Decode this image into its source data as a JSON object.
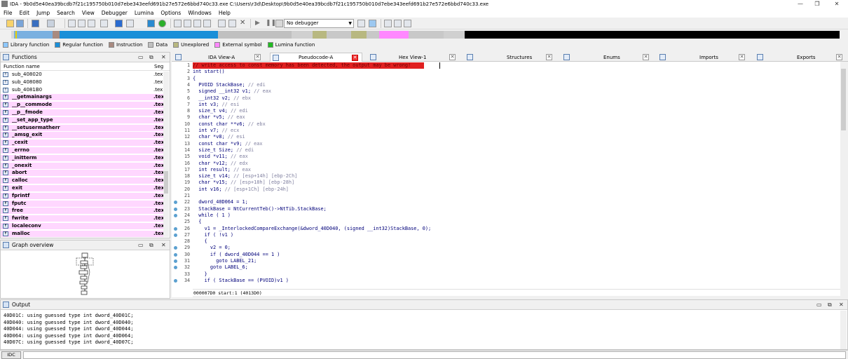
{
  "window": {
    "title": "IDA - 9b0d5e40ea39bcdb7f21c195750b010d7ebe343eefd691b27e572e6bbd740c33.exe C:\\Users\\r3d\\Desktop\\9b0d5e40ea39bcdb7f21c195750b010d7ebe343eefd691b27e572e6bbd740c33.exe",
    "minimize": "—",
    "maximize": "❐",
    "close": "✕"
  },
  "menu": [
    "File",
    "Edit",
    "Jump",
    "Search",
    "View",
    "Debugger",
    "Lumina",
    "Options",
    "Windows",
    "Help"
  ],
  "toolbar": {
    "debugger_select": "No debugger"
  },
  "legend": [
    {
      "label": "Library function",
      "color": "#8ec8ff"
    },
    {
      "label": "Regular function",
      "color": "#1a8fd8"
    },
    {
      "label": "Instruction",
      "color": "#a88a80"
    },
    {
      "label": "Data",
      "color": "#c0c0c0"
    },
    {
      "label": "Unexplored",
      "color": "#b8b880"
    },
    {
      "label": "External symbol",
      "color": "#ff88ff"
    },
    {
      "label": "Lumina function",
      "color": "#22bb22"
    }
  ],
  "functions_panel": {
    "title": "Functions",
    "col_name": "Function name",
    "col_seg": "Seg",
    "rows": [
      {
        "name": "sub_408020",
        "seg": ".tex",
        "lib": false
      },
      {
        "name": "sub_408080",
        "seg": ".tex",
        "lib": false
      },
      {
        "name": "sub_4081B0",
        "seg": ".tex",
        "lib": false
      },
      {
        "name": "__getmainargs",
        "seg": ".tex",
        "lib": true
      },
      {
        "name": "__p__commode",
        "seg": ".tex",
        "lib": true
      },
      {
        "name": "__p__fmode",
        "seg": ".tex",
        "lib": true
      },
      {
        "name": "__set_app_type",
        "seg": ".tex",
        "lib": true
      },
      {
        "name": "__setusermatherr",
        "seg": ".tex",
        "lib": true
      },
      {
        "name": "_amsg_exit",
        "seg": ".tex",
        "lib": true
      },
      {
        "name": "_cexit",
        "seg": ".tex",
        "lib": true
      },
      {
        "name": "_errno",
        "seg": ".tex",
        "lib": true
      },
      {
        "name": "_initterm",
        "seg": ".tex",
        "lib": true
      },
      {
        "name": "_onexit",
        "seg": ".tex",
        "lib": true
      },
      {
        "name": "abort",
        "seg": ".tex",
        "lib": true
      },
      {
        "name": "calloc",
        "seg": ".tex",
        "lib": true
      },
      {
        "name": "exit",
        "seg": ".tex",
        "lib": true
      },
      {
        "name": "fprintf",
        "seg": ".tex",
        "lib": true
      },
      {
        "name": "fputc",
        "seg": ".tex",
        "lib": true
      },
      {
        "name": "free",
        "seg": ".tex",
        "lib": true
      },
      {
        "name": "fwrite",
        "seg": ".tex",
        "lib": true
      },
      {
        "name": "localeconv",
        "seg": ".tex",
        "lib": true
      },
      {
        "name": "malloc",
        "seg": ".tex",
        "lib": true
      }
    ]
  },
  "graph_overview": {
    "title": "Graph overview"
  },
  "tabs": [
    {
      "label": "IDA View-A",
      "active": false
    },
    {
      "label": "Pseudocode-A",
      "active": true
    },
    {
      "label": "Hex View-1",
      "active": false
    },
    {
      "label": "Structures",
      "active": false
    },
    {
      "label": "Enums",
      "active": false
    },
    {
      "label": "Imports",
      "active": false
    },
    {
      "label": "Exports",
      "active": false
    }
  ],
  "pseudocode": {
    "lines": [
      {
        "n": "1",
        "text": "// write access to const memory has been detected, the output may be wrong!",
        "warn": true,
        "dot": false
      },
      {
        "n": "2",
        "text": "int start()",
        "dot": false
      },
      {
        "n": "3",
        "text": "{",
        "dot": false
      },
      {
        "n": "4",
        "text": "  PVOID StackBase; // edi",
        "dot": false
      },
      {
        "n": "5",
        "text": "  signed __int32 v1; // eax",
        "dot": false
      },
      {
        "n": "6",
        "text": "  __int32 v2; // ebx",
        "dot": false
      },
      {
        "n": "7",
        "text": "  int v3; // esi",
        "dot": false
      },
      {
        "n": "8",
        "text": "  size_t v4; // edi",
        "dot": false
      },
      {
        "n": "9",
        "text": "  char *v5; // eax",
        "dot": false
      },
      {
        "n": "10",
        "text": "  const char **v6; // ebx",
        "dot": false
      },
      {
        "n": "11",
        "text": "  int v7; // ecx",
        "dot": false
      },
      {
        "n": "12",
        "text": "  char *v8; // esi",
        "dot": false
      },
      {
        "n": "13",
        "text": "  const char *v9; // eax",
        "dot": false
      },
      {
        "n": "14",
        "text": "  size_t Size; // edi",
        "dot": false
      },
      {
        "n": "15",
        "text": "  void *v11; // eax",
        "dot": false
      },
      {
        "n": "16",
        "text": "  char *v12; // edx",
        "dot": false
      },
      {
        "n": "17",
        "text": "  int result; // eax",
        "dot": false
      },
      {
        "n": "18",
        "text": "  size_t v14; // [esp+14h] [ebp-2Ch]",
        "dot": false
      },
      {
        "n": "19",
        "text": "  char *v15; // [esp+18h] [ebp-28h]",
        "dot": false
      },
      {
        "n": "20",
        "text": "  int v16; // [esp+1Ch] [ebp-24h]",
        "dot": false
      },
      {
        "n": "21",
        "text": "",
        "dot": false
      },
      {
        "n": "22",
        "text": "  dword_40D064 = 1;",
        "dot": true
      },
      {
        "n": "23",
        "text": "  StackBase = NtCurrentTeb()->NtTib.StackBase;",
        "dot": true
      },
      {
        "n": "24",
        "text": "  while ( 1 )",
        "dot": true
      },
      {
        "n": "25",
        "text": "  {",
        "dot": false
      },
      {
        "n": "26",
        "text": "    v1 = _InterlockedCompareExchange(&dword_40D040, (signed __int32)StackBase, 0);",
        "dot": true
      },
      {
        "n": "27",
        "text": "    if ( !v1 )",
        "dot": true
      },
      {
        "n": "28",
        "text": "    {",
        "dot": false
      },
      {
        "n": "29",
        "text": "      v2 = 0;",
        "dot": true
      },
      {
        "n": "30",
        "text": "      if ( dword_40D044 == 1 )",
        "dot": true
      },
      {
        "n": "31",
        "text": "        goto LABEL_21;",
        "dot": true
      },
      {
        "n": "32",
        "text": "      goto LABEL_6;",
        "dot": true
      },
      {
        "n": "33",
        "text": "    }",
        "dot": false
      },
      {
        "n": "34",
        "text": "    if ( StackBase == (PVOID)v1 )",
        "dot": true
      }
    ],
    "status": "000007D0 start:1 (4013D0)"
  },
  "output": {
    "title": "Output",
    "lines": [
      "40D01C: using guessed type int dword_40D01C;",
      "40D040: using guessed type int dword_40D040;",
      "40D044: using guessed type int dword_40D044;",
      "40D064: using guessed type int dword_40D064;",
      "40D07C: using guessed type int dword_40D07C;"
    ]
  },
  "command": {
    "button": "IDC"
  }
}
